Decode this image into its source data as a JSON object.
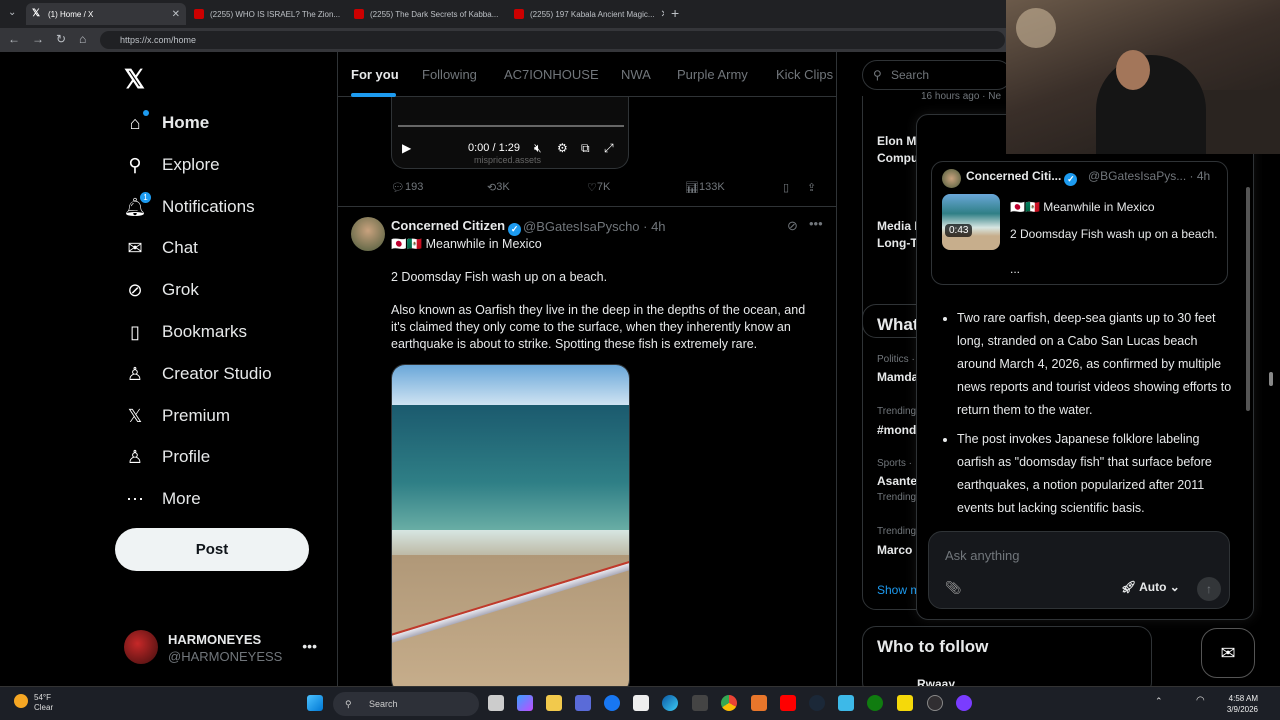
{
  "browser": {
    "tabs": [
      {
        "title": "(1) Home / X",
        "active": true
      },
      {
        "title": "(2255) WHO IS ISRAEL? The Zion..."
      },
      {
        "title": "(2255) The Dark Secrets of Kabba..."
      },
      {
        "title": "(2255) 197 Kabala Ancient Magic..."
      }
    ],
    "new_tab": "+",
    "url": "https://x.com/home"
  },
  "nav": {
    "items": [
      {
        "label": "Home",
        "icon": "home-icon",
        "glyph": "⌂"
      },
      {
        "label": "Explore",
        "icon": "search-icon",
        "glyph": "⚲"
      },
      {
        "label": "Notifications",
        "icon": "bell-icon",
        "glyph": "🔔︎",
        "badge": "1"
      },
      {
        "label": "Chat",
        "icon": "mail-icon",
        "glyph": "✉"
      },
      {
        "label": "Grok",
        "icon": "grok-icon",
        "glyph": "⊘"
      },
      {
        "label": "Bookmarks",
        "icon": "bookmark-icon",
        "glyph": "▯"
      },
      {
        "label": "Creator Studio",
        "icon": "creator-icon",
        "glyph": "♙"
      },
      {
        "label": "Premium",
        "icon": "x-premium-icon",
        "glyph": "𝕏"
      },
      {
        "label": "Profile",
        "icon": "person-icon",
        "glyph": "♙"
      },
      {
        "label": "More",
        "icon": "more-circle-icon",
        "glyph": "⋯"
      }
    ],
    "post_label": "Post",
    "account": {
      "name": "HARMONEYES",
      "handle": "@HARMONEYESS",
      "more": "•••"
    }
  },
  "timeline": {
    "tabs": [
      "For you",
      "Following",
      "AC7IONHOUSE",
      "NWA",
      "Purple Army",
      "Kick Clips"
    ],
    "prev_video": {
      "time": "0:00 / 1:29",
      "watermark": "mispriced.assets"
    },
    "prev_actions": {
      "replies": "193",
      "reposts": "3K",
      "likes": "7K",
      "views": "133K"
    },
    "tweet": {
      "name": "Concerned Citizen",
      "handle": "@BGatesIsaPyscho · 4h",
      "flags": "🇯🇵🇲🇽",
      "line1": "Meanwhile in Mexico",
      "line2": "2 Doomsday Fish wash up on a beach.",
      "line3": "Also known as Oarfish they live in the deep in the depths of the ocean, and it's claimed they only come to the surface, when they inherently know an earthquake is about to strike.  Spotting these fish is extremely rare."
    }
  },
  "right": {
    "search_placeholder": "Search",
    "trend_snippets": [
      "16 hours ago · Ne",
      "Elon M",
      "Compu",
      "Media I",
      "Long-Te"
    ],
    "whats_happening": "What",
    "trends": [
      {
        "cat": "Politics ·",
        "name": "Mamda"
      },
      {
        "cat": "Trending",
        "name": "#mond"
      },
      {
        "cat": "Sports ·",
        "name": "Asante",
        "sub": "Trending"
      },
      {
        "cat": "Trending",
        "name": "Marco"
      }
    ],
    "show_more": "Show m",
    "who_to_follow": "Who to follow",
    "follow_name": "Rwaay"
  },
  "grok": {
    "quote": {
      "name": "Concerned Citi...",
      "handle": "@BGatesIsaPys... · 4h",
      "duration": "0:43",
      "line1": "🇯🇵🇲🇽 Meanwhile in Mexico",
      "line2": "2 Doomsday Fish wash up on a beach.",
      "line3": "..."
    },
    "bullets": [
      "Two rare oarfish, deep-sea giants up to 30 feet long, stranded on a Cabo San Lucas beach around March 4, 2026, as confirmed by multiple news reports and tourist videos showing efforts to return them to the water.",
      "The post invokes Japanese folklore labeling oarfish as \"doomsday fish\" that surface before earthquakes, a notion popularized after 2011 events but lacking scientific basis."
    ],
    "ask_placeholder": "Ask anything",
    "mode": "Auto"
  },
  "taskbar": {
    "temp": "54°F",
    "condition": "Clear",
    "search": "Search",
    "time": "4:58 AM",
    "date": "3/9/2026"
  },
  "colors": {
    "accent": "#1d9bf0",
    "background": "#000000",
    "border": "#2f3336",
    "muted": "#71767b"
  }
}
